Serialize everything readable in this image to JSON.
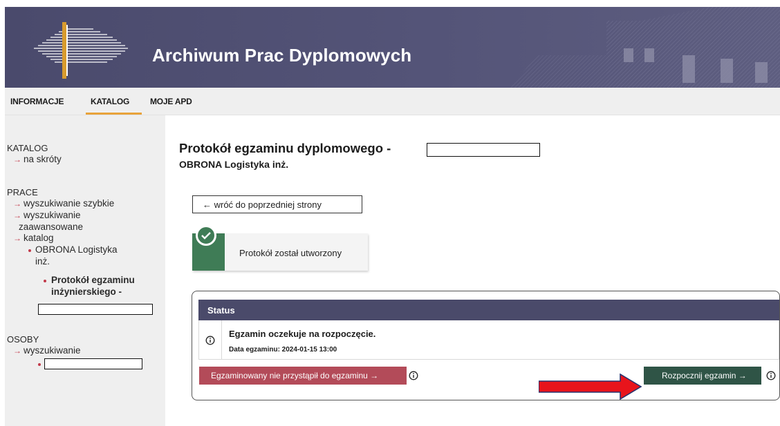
{
  "header": {
    "title": "Archiwum Prac Dyplomowych"
  },
  "nav": {
    "items": [
      "INFORMACJE",
      "KATALOG",
      "MOJE APD"
    ],
    "active": "KATALOG"
  },
  "sidebar": {
    "katalog_heading": "KATALOG",
    "katalog_link": "na skróty",
    "prace_heading": "PRACE",
    "prace_links": [
      "wyszukiwanie szybkie",
      "wyszukiwanie",
      "zaawansowane",
      "katalog"
    ],
    "catalog_item_1": [
      "OBRONA Logistyka",
      "inż."
    ],
    "catalog_item_2": [
      "Protokół egzaminu",
      "inżynierskiego -"
    ],
    "osoby_heading": "OSOBY",
    "osoby_link": "wyszukiwanie"
  },
  "main": {
    "title": "Protokół egzaminu dyplomowego -",
    "subtitle": "OBRONA Logistyka inż.",
    "back_button": "← wróć do poprzedniej strony",
    "notice": "Protokół został utworzony",
    "status_header": "Status",
    "status_message": "Egzamin oczekuje na rozpoczęcie.",
    "exam_date": "Data egzaminu: 2024-01-15 13:00",
    "absent_button": "Egzaminowany nie przystąpił do egzaminu  →",
    "start_button": "Rozpocznij egzamin  →"
  },
  "colors": {
    "header_bg": "#4a4a6c",
    "accent_underline": "#e8a33b",
    "link_arrow": "#c23a4a",
    "success_green": "#3f7c56",
    "absent_button": "#b34b59",
    "start_button": "#2f5446",
    "annotation_arrow": "#e8141c"
  },
  "icons": [
    "logo-icon",
    "check-icon",
    "info-icon",
    "arrow-right-icon"
  ]
}
